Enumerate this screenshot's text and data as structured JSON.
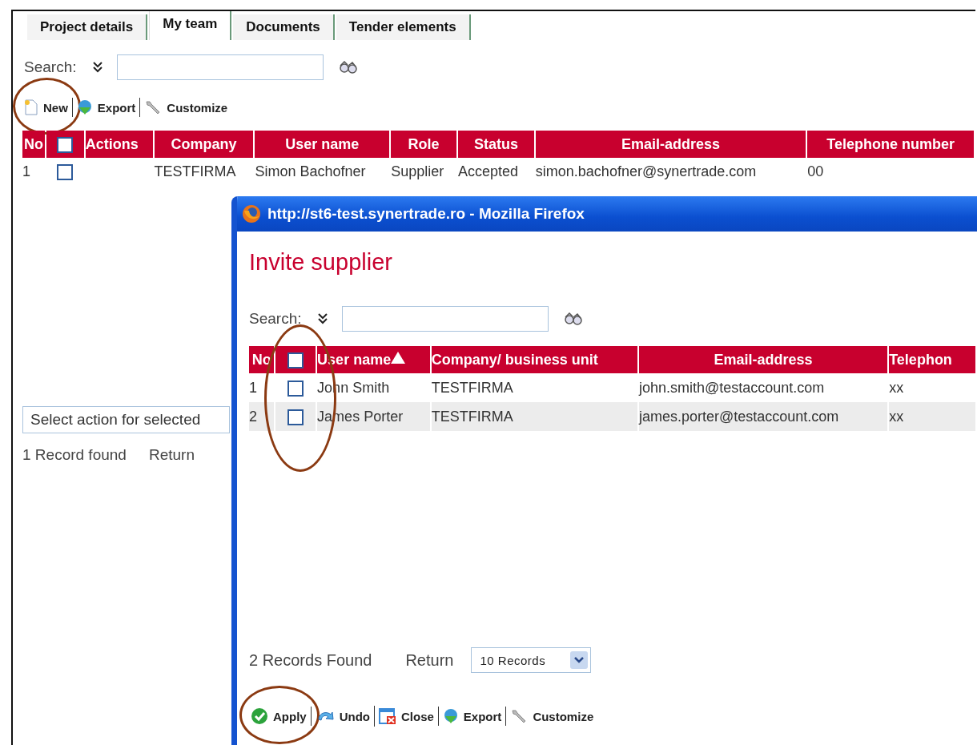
{
  "tabs": [
    {
      "label": "Project details",
      "selected": false
    },
    {
      "label": "My team",
      "selected": true
    },
    {
      "label": "Documents",
      "selected": false
    },
    {
      "label": "Tender elements",
      "selected": false
    }
  ],
  "search": {
    "label": "Search:"
  },
  "toolbar": [
    {
      "label": "New",
      "kind": "new",
      "circled": true
    },
    {
      "label": "Export",
      "kind": "export",
      "circled": false
    },
    {
      "label": "Customize",
      "kind": "customize",
      "circled": false
    }
  ],
  "table": {
    "columns": [
      {
        "kind": "text",
        "label": "No"
      },
      {
        "kind": "checkbox",
        "checked": false
      },
      {
        "kind": "text",
        "label": "Actions"
      },
      {
        "kind": "text",
        "label": "Company"
      },
      {
        "kind": "text",
        "label": "User name"
      },
      {
        "kind": "text",
        "label": "Role"
      },
      {
        "kind": "text",
        "label": "Status"
      },
      {
        "kind": "text",
        "label": "Email-address"
      },
      {
        "kind": "text",
        "label": "Telephone number"
      }
    ],
    "rows": [
      {
        "cells": [
          "1",
          {
            "checked": false
          },
          null,
          "TESTFIRMA",
          "Simon Bachofner",
          "Supplier",
          "Accepted",
          "simon.bachofner@synertrade.com",
          "00"
        ]
      }
    ]
  },
  "action_select": {
    "value": "Select action for selected"
  },
  "records_found": "1 Record found",
  "return_label": "Return",
  "popup": {
    "title": "http://st6-test.synertrade.ro - Mozilla Firefox",
    "heading": "Invite supplier",
    "search": {
      "label": "Search:"
    },
    "table": {
      "columns": [
        {
          "kind": "text",
          "label": "No"
        },
        {
          "kind": "checkbox",
          "checked": false,
          "circled": true
        },
        {
          "kind": "text",
          "label": "User name",
          "sorted": true
        },
        {
          "kind": "text",
          "label": "Company/ business unit"
        },
        {
          "kind": "text",
          "label": "Email-address"
        },
        {
          "kind": "text",
          "label": "Telephon"
        }
      ],
      "rows": [
        {
          "cells": [
            "1",
            {
              "checked": false
            },
            "John Smith",
            "TESTFIRMA",
            "john.smith@testaccount.com",
            "xx"
          ]
        },
        {
          "cells": [
            "2",
            {
              "checked": false
            },
            "James Porter",
            "TESTFIRMA",
            "james.porter@testaccount.com",
            "xx"
          ]
        }
      ]
    },
    "records_found": "2 Records Found",
    "return_label": "Return",
    "page_size": "10 Records",
    "toolbar": [
      {
        "label": "Apply",
        "kind": "apply",
        "circled": true
      },
      {
        "label": "Undo",
        "kind": "undo",
        "circled": false
      },
      {
        "label": "Close",
        "kind": "close",
        "circled": false
      },
      {
        "label": "Export",
        "kind": "export",
        "circled": false
      },
      {
        "label": "Customize",
        "kind": "customize",
        "circled": false
      }
    ]
  }
}
